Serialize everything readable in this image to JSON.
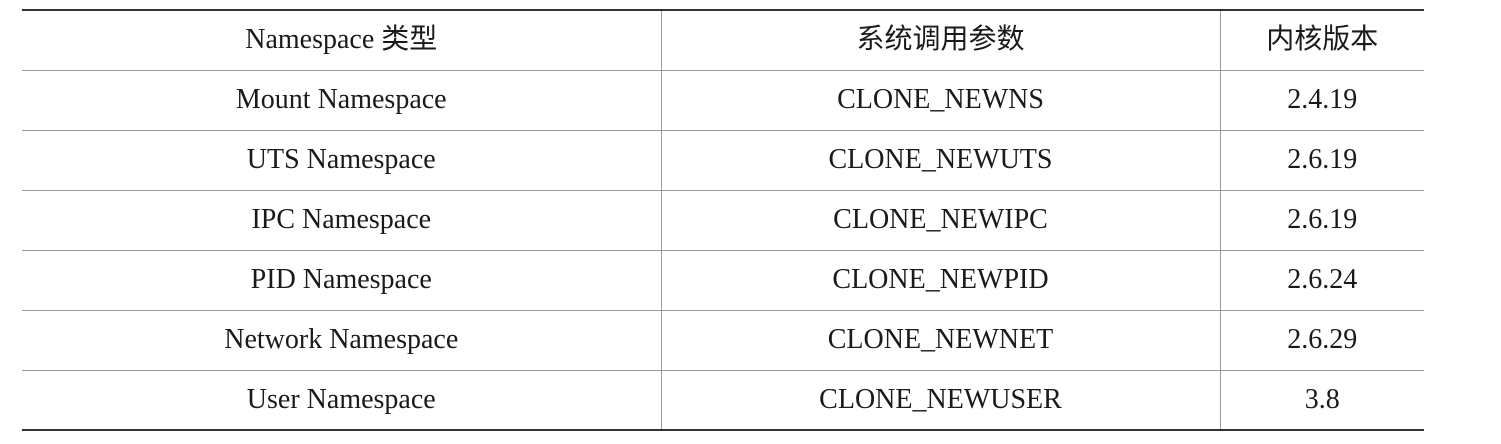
{
  "table": {
    "headers": [
      "Namespace 类型",
      "系统调用参数",
      "内核版本"
    ],
    "rows": [
      [
        "Mount Namespace",
        "CLONE_NEWNS",
        "2.4.19"
      ],
      [
        "UTS Namespace",
        "CLONE_NEWUTS",
        "2.6.19"
      ],
      [
        "IPC Namespace",
        "CLONE_NEWIPC",
        "2.6.19"
      ],
      [
        "PID Namespace",
        "CLONE_NEWPID",
        "2.6.24"
      ],
      [
        "Network Namespace",
        "CLONE_NEWNET",
        "2.6.29"
      ],
      [
        "User Namespace",
        "CLONE_NEWUSER",
        "3.8"
      ]
    ]
  }
}
